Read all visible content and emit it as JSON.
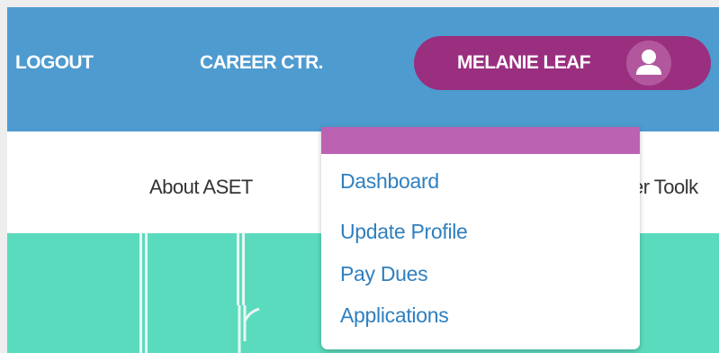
{
  "header": {
    "logout_label": "LOGOUT",
    "career_label": "CAREER CTR.",
    "user_name": "MELANIE LEAF",
    "avatar_icon": "user-silhouette-icon"
  },
  "nav": {
    "items": [
      "About ASET",
      "er Toolk"
    ]
  },
  "user_menu": {
    "items": [
      "Dashboard",
      "Update Profile",
      "Pay Dues",
      "Applications"
    ]
  },
  "colors": {
    "header_bg": "#4e9bd0",
    "user_pill": "#9a2f7f",
    "dropdown_accent": "#bb63b2",
    "menu_link": "#2f7fbf",
    "hero_bg": "#5bdbbd"
  }
}
